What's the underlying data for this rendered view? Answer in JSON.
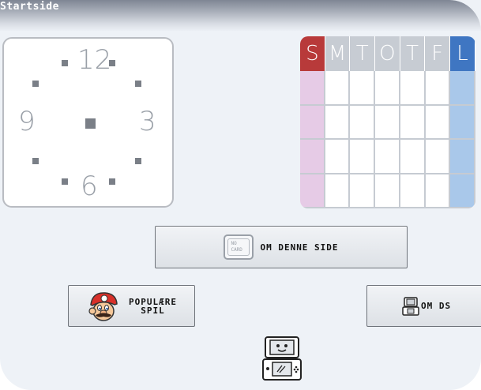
{
  "window": {
    "title": "Startside"
  },
  "clock": {
    "numbers": {
      "twelve": "12",
      "three": "3",
      "six": "6",
      "nine": "9"
    }
  },
  "calendar": {
    "days": [
      "S",
      "M",
      "T",
      "O",
      "T",
      "F",
      "L"
    ],
    "colors": {
      "sunday_header": "#b83a3a",
      "saturday_header": "#3f76c2",
      "weekday_header": "#c7ccd3",
      "sunday_column": "#e6cbe6",
      "saturday_column": "#a9c8ea"
    },
    "rows": 4
  },
  "buttons": {
    "about_page": {
      "label": "OM DENNE SIDE",
      "icon": "no-card-icon",
      "icon_text": [
        "NO",
        "CARD"
      ]
    },
    "popular_games": {
      "label_line1": "POPULÆRE",
      "label_line2": "SPIL",
      "icon": "mario-icon"
    },
    "about_ds": {
      "label": "OM DS",
      "icon": "nintendo-ds-icon"
    }
  },
  "footer": {
    "icon": "nintendo-ds-icon"
  }
}
